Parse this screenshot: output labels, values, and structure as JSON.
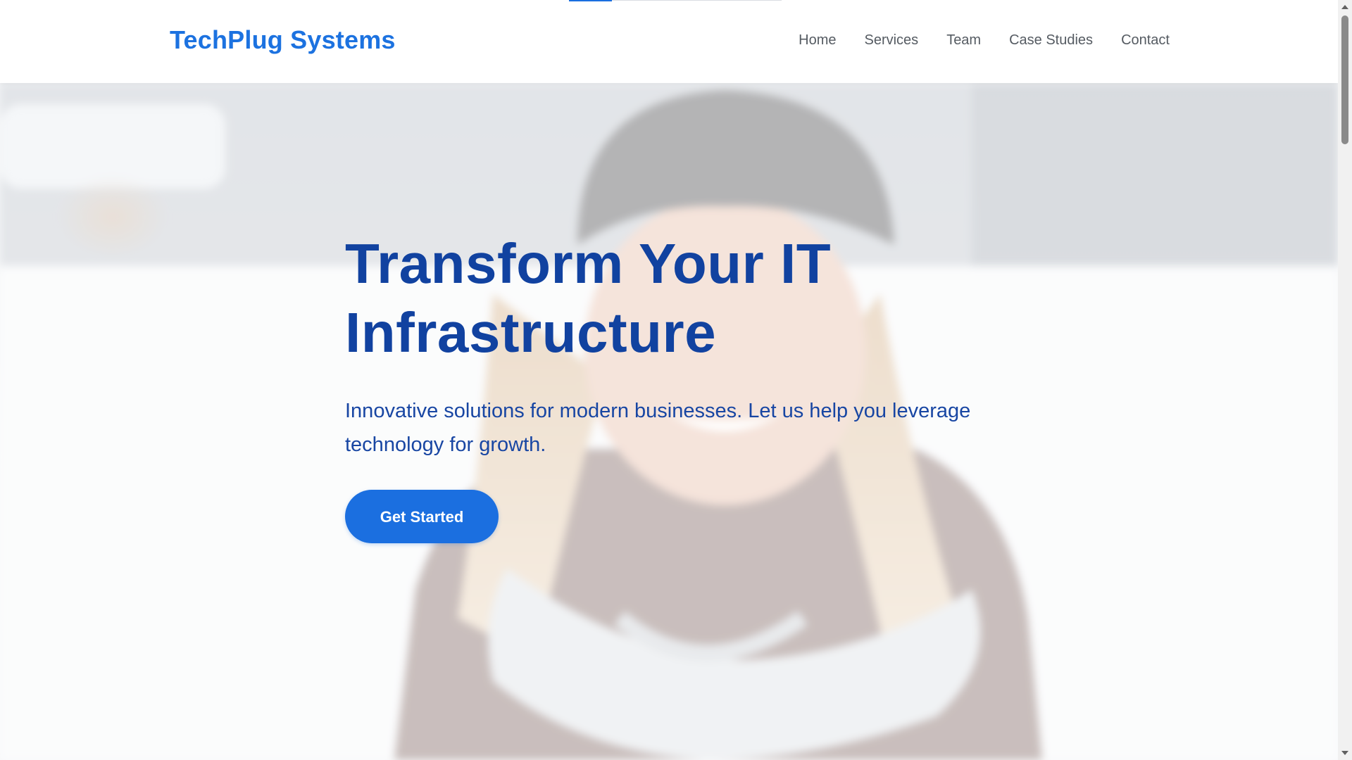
{
  "header": {
    "logo": "TechPlug Systems",
    "nav": [
      "Home",
      "Services",
      "Team",
      "Case Studies",
      "Contact"
    ]
  },
  "hero": {
    "title_line1": "Transform Your IT",
    "title_line2": "Infrastructure",
    "subtitle": "Innovative solutions for modern businesses. Let us help you leverage technology for growth.",
    "cta_label": "Get Started",
    "background_image": "blurred photo of a smiling woman in a black beanie and light scarf outdoors in snow"
  },
  "colors": {
    "brand": "#1c72e0",
    "heading": "#1142a0",
    "nav_text": "#555b62",
    "button": "#1b6fe0"
  }
}
